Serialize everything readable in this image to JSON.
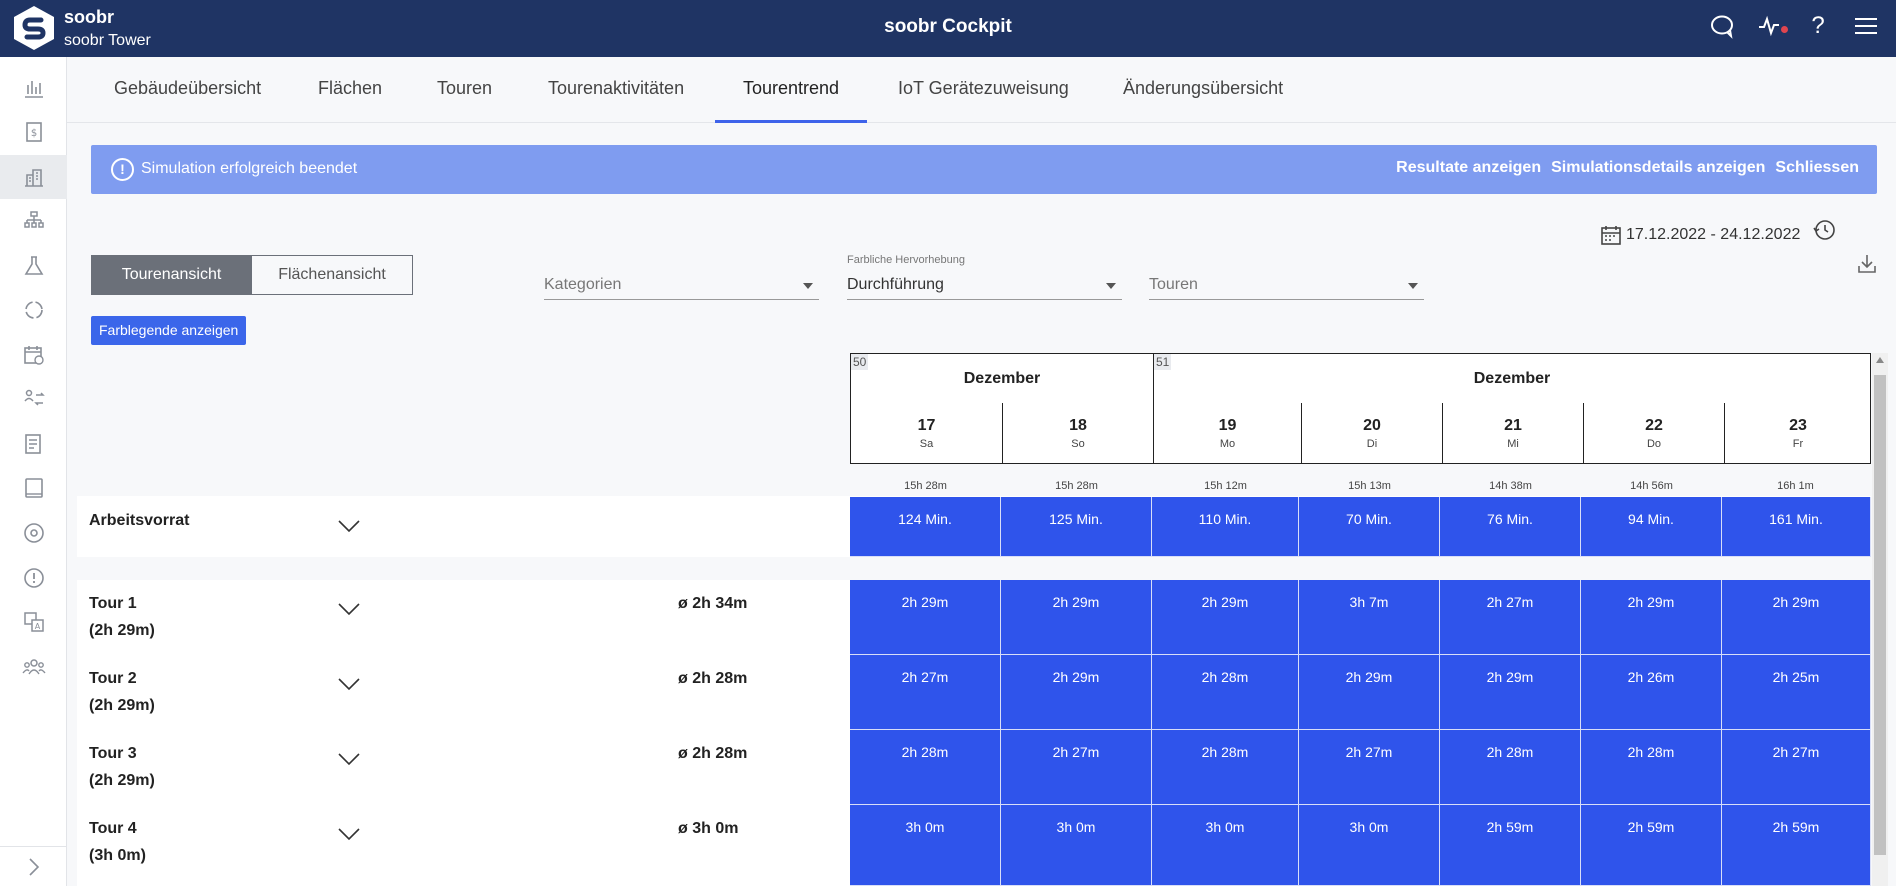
{
  "topbar": {
    "brand": "soobr",
    "building": "soobr Tower",
    "title": "soobr Cockpit"
  },
  "tabs": [
    {
      "label": "Gebäudeübersicht"
    },
    {
      "label": "Flächen"
    },
    {
      "label": "Touren"
    },
    {
      "label": "Tourenaktivitäten"
    },
    {
      "label": "Tourentrend",
      "active": true
    },
    {
      "label": "IoT Gerätezuweisung"
    },
    {
      "label": "Änderungsübersicht"
    }
  ],
  "alert": {
    "message": "Simulation erfolgreich beendet",
    "actions": [
      "Resultate anzeigen",
      "Simulationsdetails anzeigen",
      "Schliessen"
    ]
  },
  "view_toggle": {
    "tour_view": "Tourenansicht",
    "area_view": "Flächenansicht",
    "selected": "Tourenansicht"
  },
  "legend_button": "Farblegende anzeigen",
  "filters": {
    "categories_placeholder": "Kategorien",
    "highlight_label": "Farbliche Hervorhebung",
    "highlight_value": "Durchführung",
    "tours_placeholder": "Touren"
  },
  "date_range": "17.12.2022 - 24.12.2022",
  "calendar": {
    "weeks": [
      {
        "number": "50",
        "month": "Dezember"
      },
      {
        "number": "51",
        "month": "Dezember"
      }
    ],
    "days": [
      {
        "num": "17",
        "name": "Sa",
        "duration": "15h 28m"
      },
      {
        "num": "18",
        "name": "So",
        "duration": "15h 28m"
      },
      {
        "num": "19",
        "name": "Mo",
        "duration": "15h 12m"
      },
      {
        "num": "20",
        "name": "Di",
        "duration": "15h 13m"
      },
      {
        "num": "21",
        "name": "Mi",
        "duration": "14h 38m"
      },
      {
        "num": "22",
        "name": "Do",
        "duration": "14h 56m"
      },
      {
        "num": "23",
        "name": "Fr",
        "duration": "16h 1m"
      }
    ]
  },
  "rows": [
    {
      "title": "Arbeitsvorrat",
      "subtitle": "",
      "average": "",
      "values": [
        "124 Min.",
        "125 Min.",
        "110 Min.",
        "70 Min.",
        "76 Min.",
        "94 Min.",
        "161 Min."
      ]
    },
    {
      "title": "Tour 1",
      "subtitle": "(2h 29m)",
      "average": "ø 2h 34m",
      "values": [
        "2h 29m",
        "2h 29m",
        "2h 29m",
        "3h 7m",
        "2h 27m",
        "2h 29m",
        "2h 29m"
      ]
    },
    {
      "title": "Tour 2",
      "subtitle": "(2h 29m)",
      "average": "ø 2h 28m",
      "values": [
        "2h 27m",
        "2h 29m",
        "2h 28m",
        "2h 29m",
        "2h 29m",
        "2h 26m",
        "2h 25m"
      ]
    },
    {
      "title": "Tour 3",
      "subtitle": "(2h 29m)",
      "average": "ø 2h 28m",
      "values": [
        "2h 28m",
        "2h 27m",
        "2h 28m",
        "2h 27m",
        "2h 28m",
        "2h 28m",
        "2h 27m"
      ]
    },
    {
      "title": "Tour 4",
      "subtitle": "(3h 0m)",
      "average": "ø 3h 0m",
      "values": [
        "3h 0m",
        "3h 0m",
        "3h 0m",
        "3h 0m",
        "2h 59m",
        "2h 59m",
        "2h 59m"
      ]
    }
  ],
  "colors": {
    "topbar": "#1f3464",
    "accent": "#3e63ea",
    "alert": "#7f9cf0",
    "cell": "#2f54eb"
  },
  "sidebar_icons": [
    "bar-chart-icon",
    "invoice-icon",
    "building-icon",
    "org-chart-icon",
    "flask-icon",
    "cycle-icon",
    "calendar-clock-icon",
    "transfer-icon",
    "list-icon",
    "tablet-icon",
    "sensor-icon",
    "alert-icon",
    "translate-icon",
    "team-icon"
  ]
}
